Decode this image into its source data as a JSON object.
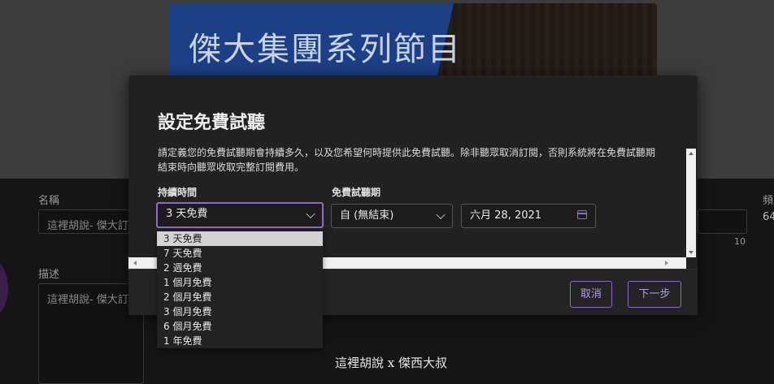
{
  "background": {
    "banner_title": "傑大集團系列節目",
    "name_label": "名稱",
    "name_value": "這裡胡說- 傑大訂",
    "name_counter": "10",
    "desc_label": "描述",
    "desc_value": "這裡胡說- 傑大訂",
    "right_label": "頻",
    "right_value": "64",
    "caption": "這裡胡說 x 傑西大叔"
  },
  "modal": {
    "title": "設定免費試聽",
    "description": "請定義您的免費試聽期會持續多久，以及您希望何時提供此免費試聽。除非聽眾取消訂閱，否則系統將在免費試聽期結束時向聽眾收取完整訂閱費用。",
    "duration": {
      "label": "持續時間",
      "selected": "3 天免費",
      "options": [
        "3 天免費",
        "7 天免費",
        "2 週免費",
        "1 個月免費",
        "2 個月免費",
        "3 個月免費",
        "6 個月免費",
        "1 年免費"
      ]
    },
    "trial_period": {
      "label": "免費試聽期",
      "start_selected": "自 (無結束)",
      "date_value": "六月 28, 2021"
    },
    "cancel_label": "取消",
    "next_label": "下一步"
  },
  "colors": {
    "accent": "#8c6cc7",
    "accent_text": "#b79ae8",
    "modal_bg": "#212121"
  },
  "icons": [
    "chevron-down-icon",
    "calendar-icon",
    "scroll-arrow-icon"
  ]
}
